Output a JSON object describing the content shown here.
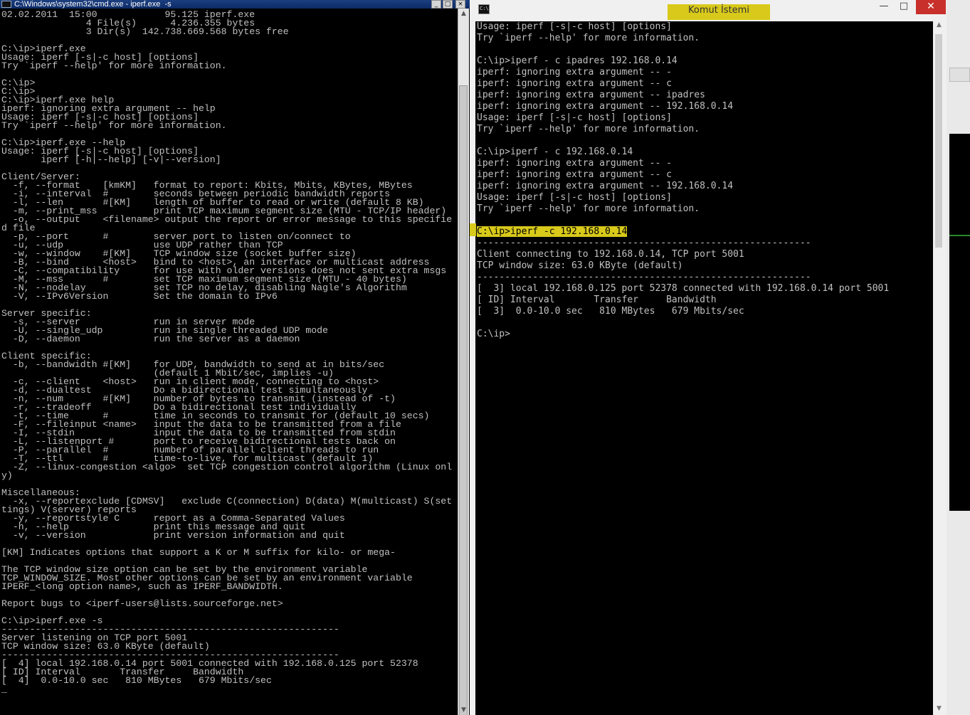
{
  "left_window": {
    "title": "C:\\Windows\\system32\\cmd.exe - iperf.exe  -s",
    "buttons": {
      "minimize": "_",
      "maximize": "□",
      "close": "×"
    },
    "console_text": "02.02.2011  15:00            95.125 iperf.exe\n               4 File(s)      4.236.355 bytes\n               3 Dir(s)  142.738.669.568 bytes free\n\nC:\\ip>iperf.exe\nUsage: iperf [-s|-c host] [options]\nTry `iperf --help' for more information.\n\nC:\\ip>\nC:\\ip>\nC:\\ip>iperf.exe help\niperf: ignoring extra argument -- help\nUsage: iperf [-s|-c host] [options]\nTry `iperf --help' for more information.\n\nC:\\ip>iperf.exe --help\nUsage: iperf [-s|-c host] [options]\n       iperf [-h|--help] [-v|--version]\n\nClient/Server:\n  -f, --format    [kmKM]   format to report: Kbits, Mbits, KBytes, MBytes\n  -i, --interval  #        seconds between periodic bandwidth reports\n  -l, --len       #[KM]    length of buffer to read or write (default 8 KB)\n  -m, --print_mss          print TCP maximum segment size (MTU - TCP/IP header)\n  -o, --output    <filename> output the report or error message to this specifie\nd file\n  -p, --port      #        server port to listen on/connect to\n  -u, --udp                use UDP rather than TCP\n  -w, --window    #[KM]    TCP window size (socket buffer size)\n  -B, --bind      <host>   bind to <host>, an interface or multicast address\n  -C, --compatibility      for use with older versions does not sent extra msgs\n  -M, --mss       #        set TCP maximum segment size (MTU - 40 bytes)\n  -N, --nodelay            set TCP no delay, disabling Nagle's Algorithm\n  -V, --IPv6Version        Set the domain to IPv6\n\nServer specific:\n  -s, --server             run in server mode\n  -U, --single_udp         run in single threaded UDP mode\n  -D, --daemon             run the server as a daemon\n\nClient specific:\n  -b, --bandwidth #[KM]    for UDP, bandwidth to send at in bits/sec\n                           (default 1 Mbit/sec, implies -u)\n  -c, --client    <host>   run in client mode, connecting to <host>\n  -d, --dualtest           Do a bidirectional test simultaneously\n  -n, --num       #[KM]    number of bytes to transmit (instead of -t)\n  -r, --tradeoff           Do a bidirectional test individually\n  -t, --time      #        time in seconds to transmit for (default 10 secs)\n  -F, --fileinput <name>   input the data to be transmitted from a file\n  -I, --stdin              input the data to be transmitted from stdin\n  -L, --listenport #       port to receive bidirectional tests back on\n  -P, --parallel  #        number of parallel client threads to run\n  -T, --ttl       #        time-to-live, for multicast (default 1)\n  -Z, --linux-congestion <algo>  set TCP congestion control algorithm (Linux onl\ny)\n\nMiscellaneous:\n  -x, --reportexclude [CDMSV]   exclude C(connection) D(data) M(multicast) S(set\ntings) V(server) reports\n  -y, --reportstyle C      report as a Comma-Separated Values\n  -h, --help               print this message and quit\n  -v, --version            print version information and quit\n\n[KM] Indicates options that support a K or M suffix for kilo- or mega-\n\nThe TCP window size option can be set by the environment variable\nTCP_WINDOW_SIZE. Most other options can be set by an environment variable\nIPERF_<long option name>, such as IPERF_BANDWIDTH.\n\nReport bugs to <iperf-users@lists.sourceforge.net>\n\nC:\\ip>iperf.exe -s\n------------------------------------------------------------\nServer listening on TCP port 5001\nTCP window size: 63.0 KByte (default)\n------------------------------------------------------------\n[  4] local 192.168.0.14 port 5001 connected with 192.168.0.125 port 52378\n[ ID] Interval       Transfer     Bandwidth\n[  4]  0.0-10.0 sec   810 MBytes   679 Mbits/sec\n_"
  },
  "right_window": {
    "title": "Komut İstemi",
    "buttons": {
      "minimize": "—",
      "maximize": "□",
      "close": "✕"
    },
    "console_before": "Usage: iperf [-s|-c host] [options]\nTry `iperf --help' for more information.\n\nC:\\ip>iperf - c ipadres 192.168.0.14\niperf: ignoring extra argument -- -\niperf: ignoring extra argument -- c\niperf: ignoring extra argument -- ipadres\niperf: ignoring extra argument -- 192.168.0.14\nUsage: iperf [-s|-c host] [options]\nTry `iperf --help' for more information.\n\nC:\\ip>iperf - c 192.168.0.14\niperf: ignoring extra argument -- -\niperf: ignoring extra argument -- c\niperf: ignoring extra argument -- 192.168.0.14\nUsage: iperf [-s|-c host] [options]\nTry `iperf --help' for more information.\n\n",
    "console_highlight": "C:\\ip>iperf -c 192.168.0.14",
    "console_after": "\n------------------------------------------------------------\nClient connecting to 192.168.0.14, TCP port 5001\nTCP window size: 63.0 KByte (default)\n------------------------------------------------------------\n[  3] local 192.168.0.125 port 52378 connected with 192.168.0.14 port 5001\n[ ID] Interval       Transfer     Bandwidth\n[  3]  0.0-10.0 sec   810 MBytes   679 Mbits/sec\n\nC:\\ip>"
  },
  "colors": {
    "console_bg": "#000000",
    "console_fg": "#c0c0c0",
    "highlight": "#d8c91a",
    "close_button": "#c7302b"
  },
  "icons": {
    "left_window_icon": "cmd-icon",
    "right_window_icon": "cmd-icon"
  }
}
